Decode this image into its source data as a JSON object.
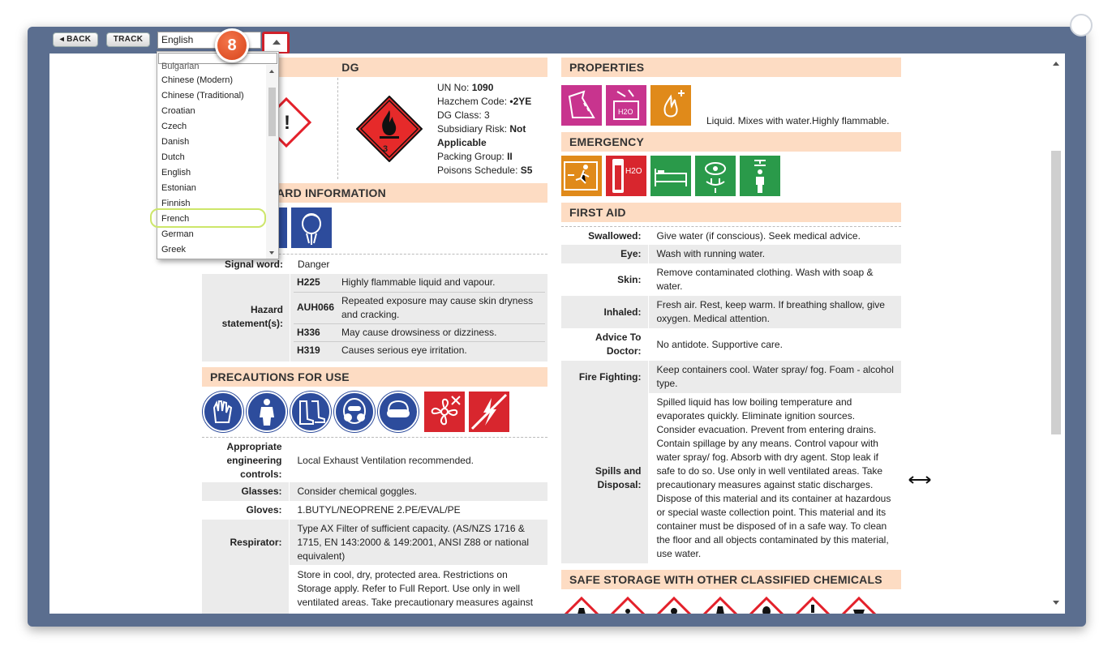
{
  "toolbar": {
    "back_label": "◂ BACK",
    "track_label": "TRACK",
    "language_value": "English"
  },
  "step_badge": "8",
  "language_options": [
    "Bulgarian",
    "Chinese (Modern)",
    "Chinese (Traditional)",
    "Croatian",
    "Czech",
    "Danish",
    "Dutch",
    "English",
    "Estonian",
    "Finnish",
    "French",
    "German",
    "Greek"
  ],
  "dg": {
    "header": "DG",
    "un_label": "UN No:",
    "un_value": "1090",
    "hazchem_label": "Hazchem Code:",
    "hazchem_value": "•2YE",
    "dg_class_label": "DG Class:",
    "dg_class_value": "3",
    "subsidiary_label": "Subsidiary Risk:",
    "subsidiary_value": "Not",
    "subsidiary_value2": "Applicable",
    "packing_label": "Packing Group:",
    "packing_value": "II",
    "poisons_label": "Poisons Schedule:",
    "poisons_value": "S5",
    "diamond_number": "3"
  },
  "hazard": {
    "header": "ARD INFORMATION",
    "signal_label": "Signal word:",
    "signal_value": "Danger",
    "statements_label": "Hazard statement(s):",
    "statements": [
      {
        "code": "H225",
        "text": "Highly flammable liquid and vapour."
      },
      {
        "code": "AUH066",
        "text": "Repeated exposure may cause skin dryness and cracking."
      },
      {
        "code": "H336",
        "text": "May cause drowsiness or dizziness."
      },
      {
        "code": "H319",
        "text": "Causes serious eye irritation."
      }
    ]
  },
  "precautions": {
    "header": "PRECAUTIONS FOR USE",
    "rows": [
      {
        "k": "Appropriate engineering controls:",
        "v": "Local Exhaust Ventilation recommended."
      },
      {
        "k": "Glasses:",
        "v": "Consider chemical goggles."
      },
      {
        "k": "Gloves:",
        "v": "1.BUTYL/NEOPRENE 2.PE/EVAL/PE"
      },
      {
        "k": "Respirator:",
        "v": "Type AX Filter of sufficient capacity. (AS/NZS 1716 & 1715, EN 143:2000 & 149:2001, ANSI Z88 or national equivalent)"
      },
      {
        "k": "",
        "v": "Store in cool, dry, protected area. Restrictions on Storage apply. Refer to Full Report. Use only in well ventilated areas. Take precautionary measures against"
      }
    ]
  },
  "properties": {
    "header": "PROPERTIES",
    "text": "Liquid. Mixes with water.Highly flammable.",
    "icon_label_h2o": "H2O"
  },
  "emergency": {
    "header": "EMERGENCY",
    "icon_label_h2o": "H2O"
  },
  "first_aid": {
    "header": "FIRST AID",
    "rows": [
      {
        "k": "Swallowed:",
        "v": "Give water (if conscious). Seek medical advice."
      },
      {
        "k": "Eye:",
        "v": "Wash with running water."
      },
      {
        "k": "Skin:",
        "v": "Remove contaminated clothing. Wash with soap & water."
      },
      {
        "k": "Inhaled:",
        "v": "Fresh air. Rest, keep warm. If breathing shallow, give oxygen. Medical attention."
      },
      {
        "k": "Advice To Doctor:",
        "v": "No antidote. Supportive care."
      },
      {
        "k": "Fire Fighting:",
        "v": "Keep containers cool. Water spray/ fog. Foam - alcohol type."
      },
      {
        "k": "Spills and Disposal:",
        "v": "Spilled liquid has low boiling temperature and evaporates quickly. Eliminate ignition sources. Consider evacuation. Prevent from entering drains. Contain spillage by any means. Control vapour with water spray/ fog. Absorb with dry agent. Stop leak if safe to do so. Use only in well ventilated areas. Take precautionary measures against static discharges. Dispose of this material and its container at hazardous or special waste collection point. This material and its container must be disposed of in a safe way. To clean the floor and all objects contaminated by this material, use water."
      }
    ]
  },
  "safe_storage": {
    "header": "SAFE STORAGE WITH OTHER CLASSIFIED CHEMICALS"
  },
  "colors": {
    "frame": "#5b6e8f",
    "section_header": "#fddcc3",
    "highlight_box": "#d0202a",
    "badge": "#e0552a",
    "ppe_blue": "#2d4c9c",
    "emergency_green": "#2a9a4a",
    "property_pink": "#c8348e",
    "property_orange": "#e08a1a"
  }
}
